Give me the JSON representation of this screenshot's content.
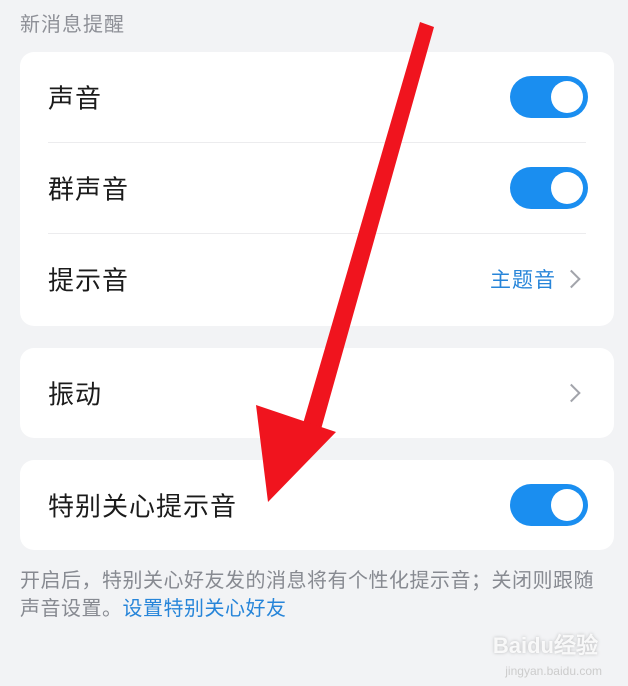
{
  "section_title": "新消息提醒",
  "settings_group": {
    "rows": [
      {
        "label": "声音",
        "toggle_on": true
      },
      {
        "label": "群声音",
        "toggle_on": true
      },
      {
        "label": "提示音",
        "value": "主题音"
      }
    ]
  },
  "vibrate": {
    "label": "振动"
  },
  "special_care": {
    "label": "特别关心提示音",
    "toggle_on": true
  },
  "description": {
    "text": "开启后，特别关心好友发的消息将有个性化提示音；关闭则跟随声音设置。",
    "link": "设置特别关心好友"
  },
  "watermark": {
    "brand": "Baidu经验",
    "sub": "jingyan.baidu.com"
  },
  "colors": {
    "accent": "#1a8ef0",
    "link": "#2785d9",
    "annotation_arrow": "#f0141e"
  },
  "icons": {
    "chevron": "chevron-right-icon",
    "annotation": "red-arrow-annotation"
  }
}
